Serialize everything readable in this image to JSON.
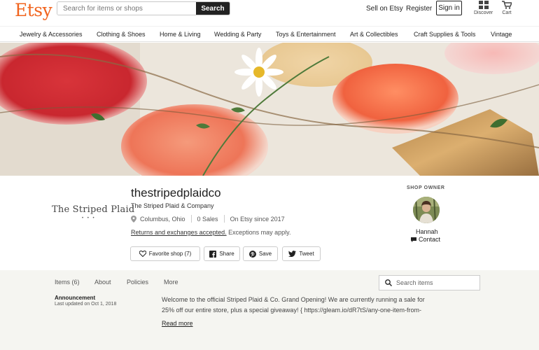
{
  "header": {
    "logo": "Etsy",
    "search_placeholder": "Search for items or shops",
    "search_button": "Search",
    "sell_link": "Sell on Etsy",
    "register_link": "Register",
    "signin_button": "Sign in",
    "discover_label": "Discover",
    "cart_label": "Cart"
  },
  "categories": [
    "Jewelry & Accessories",
    "Clothing & Shoes",
    "Home & Living",
    "Wedding & Party",
    "Toys & Entertainment",
    "Art & Collectibles",
    "Craft Supplies & Tools",
    "Vintage"
  ],
  "shop": {
    "logo_text": "The Striped Plaid",
    "logo_dots": "• • •",
    "name": "thestripedplaidco",
    "title": "The Striped Plaid & Company",
    "location": "Columbus, Ohio",
    "sales": "0 Sales",
    "since": "On Etsy since 2017",
    "returns_link": "Returns and exchanges accepted.",
    "returns_note": " Exceptions may apply."
  },
  "actions": {
    "favorite": "Favorite shop (7)",
    "share": "Share",
    "save": "Save",
    "tweet": "Tweet"
  },
  "owner": {
    "label": "SHOP OWNER",
    "name": "Hannah",
    "contact": "Contact"
  },
  "tabs": [
    "Items (6)",
    "About",
    "Policies",
    "More"
  ],
  "items_search_placeholder": "Search items",
  "announcement": {
    "title": "Announcement",
    "updated": "Last updated on Oct 1, 2018",
    "line1": "Welcome to the official Striped Plaid & Co. Grand Opening! We are currently running a sale for",
    "line2": "25% off our entire store, plus a special giveaway! { https://gleam.io/dR7tS/any-one-item-from-",
    "read_more": "Read more"
  },
  "colors": {
    "brand": "#f1641e",
    "dark": "#222222",
    "panel": "#f5f5f1"
  }
}
